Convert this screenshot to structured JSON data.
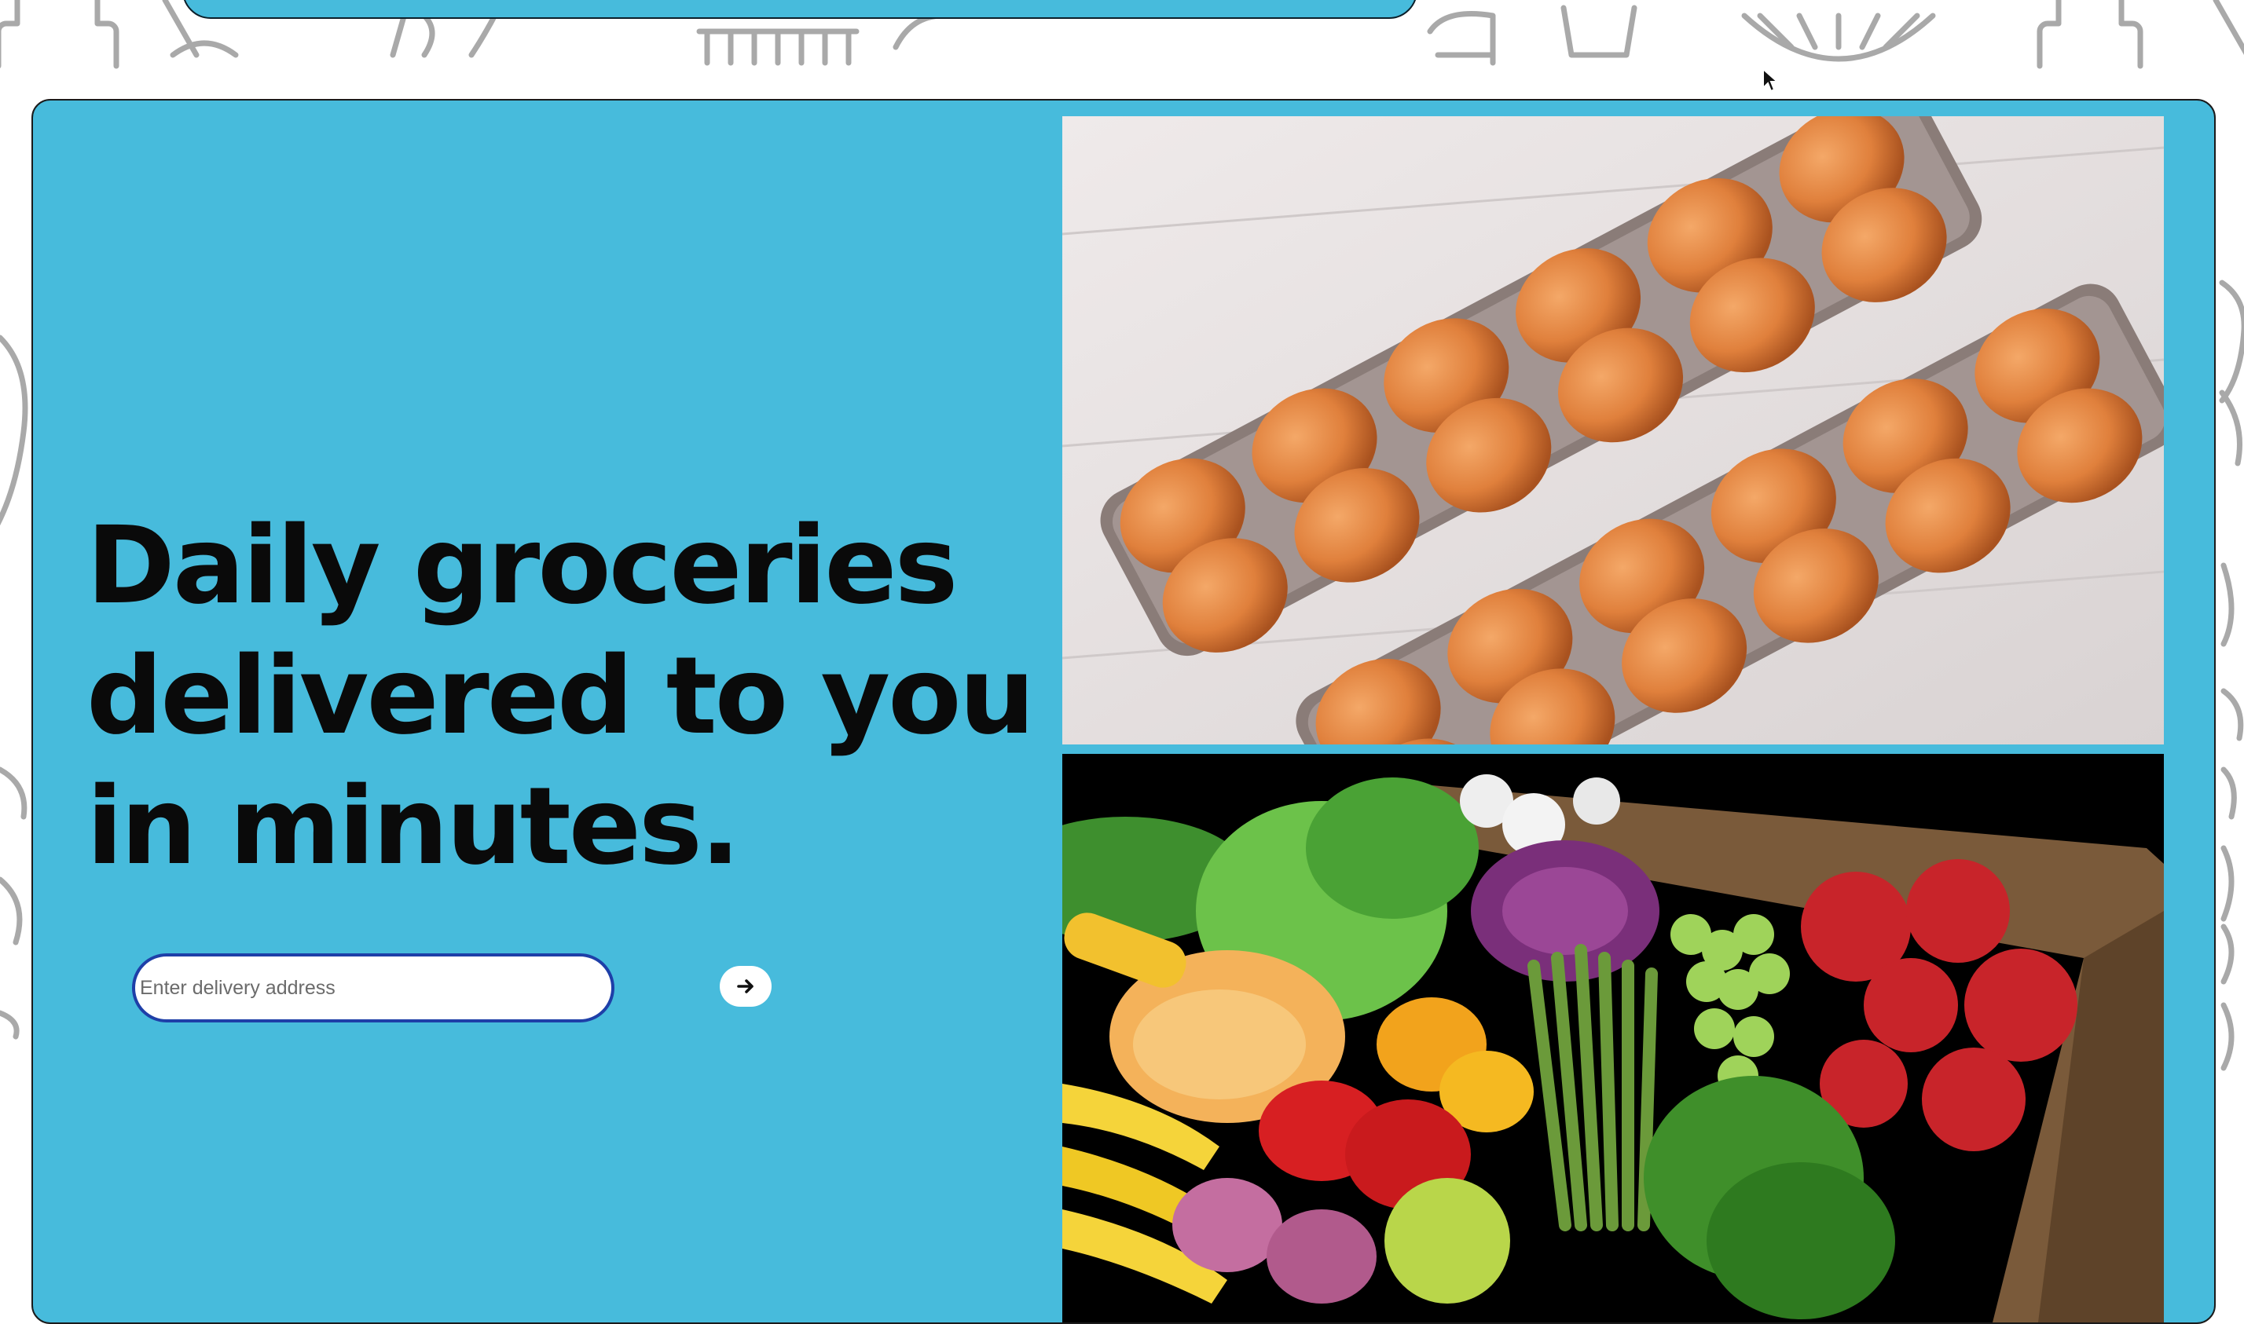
{
  "hero": {
    "headline": "Daily groceries delivered to you in minutes.",
    "address_placeholder": "Enter delivery address",
    "address_value": ""
  },
  "images": {
    "eggs": "eggs-in-cartons",
    "produce": "fresh-produce-crate"
  },
  "icons": {
    "submit": "arrow-right-icon",
    "background": "kitchen-utensils-pattern"
  },
  "colors": {
    "hero_background": "#47bbdc",
    "input_border": "#1e3fa8",
    "headline": "#0a0a0a"
  }
}
